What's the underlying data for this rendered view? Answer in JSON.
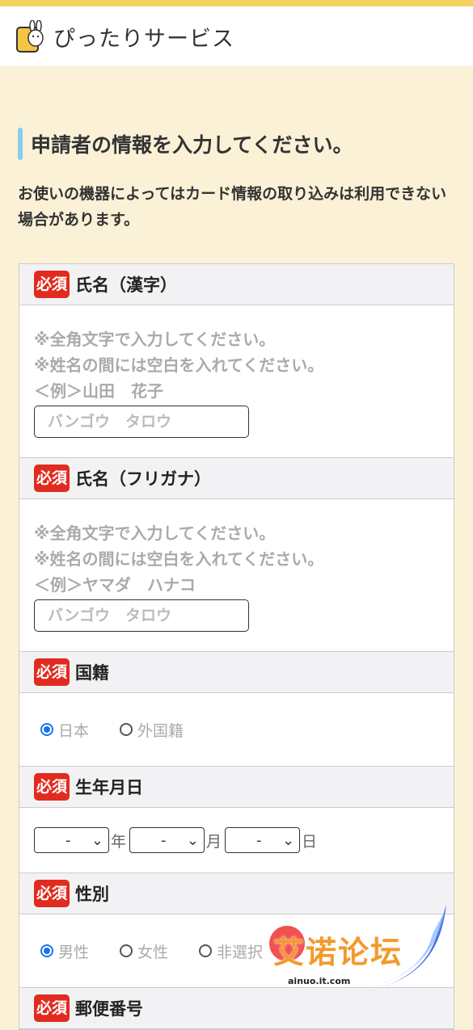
{
  "header": {
    "app_title": "ぴったりサービス"
  },
  "page": {
    "heading": "申請者の情報を入力してください。",
    "notice": "お使いの機器によってはカード情報の取り込みは利用できない場合があります。"
  },
  "fields": {
    "required_badge": "必須",
    "name_kanji": {
      "label": "氏名（漢字）",
      "hint1": "※全角文字で入力してください。",
      "hint2": "※姓名の間には空白を入れてください。",
      "example": "＜例＞山田　花子",
      "placeholder": "バンゴウ　タロウ"
    },
    "name_kana": {
      "label": "氏名（フリガナ）",
      "hint1": "※全角文字で入力してください。",
      "hint2": "※姓名の間には空白を入れてください。",
      "example": "＜例＞ヤマダ　ハナコ",
      "placeholder": "バンゴウ　タロウ"
    },
    "nationality": {
      "label": "国籍",
      "options": [
        "日本",
        "外国籍"
      ],
      "selected": "日本"
    },
    "birthdate": {
      "label": "生年月日",
      "year_value": "-",
      "month_value": "-",
      "day_value": "-",
      "year_unit": "年",
      "month_unit": "月",
      "day_unit": "日"
    },
    "gender": {
      "label": "性別",
      "options": [
        "男性",
        "女性",
        "非選択"
      ],
      "selected": "男性"
    },
    "postal": {
      "label": "郵便番号"
    }
  },
  "watermark": {
    "text": "艾诺论坛",
    "url": "ainuo.it.com"
  }
}
